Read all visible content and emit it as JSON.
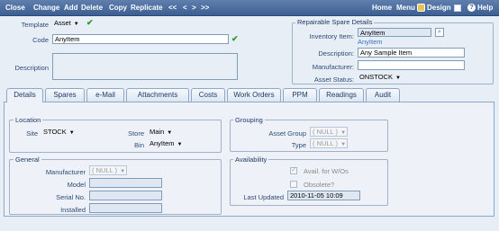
{
  "toolbar": {
    "close": "Close",
    "change": "Change",
    "add": "Add",
    "delete": "Delete",
    "copy": "Copy",
    "replicate": "Replicate",
    "first": "<<",
    "prev": "<",
    "next": ">",
    "last": ">>",
    "home": "Home",
    "menu": "Menu",
    "design": "Design",
    "help": "Help"
  },
  "header": {
    "template_label": "Template",
    "template_value": "Asset",
    "code_label": "Code",
    "code_value": "AnyItem",
    "description_label": "Description",
    "description_value": ""
  },
  "spare": {
    "title": "Repairable Spare Details",
    "inventory_label": "Inventory Item:",
    "inventory_value": "AnyItem",
    "inventory_link": "AnyItem",
    "description_label": "Description:",
    "description_value": "Any Sample Item",
    "manufacturer_label": "Manufacturer:",
    "manufacturer_value": "",
    "status_label": "Asset Status:",
    "status_value": "ONSTOCK"
  },
  "tabs": [
    "Details",
    "Spares",
    "e-Mail",
    "Attachments",
    "Costs",
    "Work Orders",
    "PPM",
    "Readings",
    "Audit"
  ],
  "location": {
    "title": "Location",
    "site_label": "Site",
    "site_value": "STOCK",
    "store_label": "Store",
    "store_value": "Main",
    "bin_label": "Bin",
    "bin_value": "AnyItem"
  },
  "grouping": {
    "title": "Grouping",
    "asset_group_label": "Asset Group",
    "asset_group_value": "( NULL )",
    "type_label": "Type",
    "type_value": "( NULL )"
  },
  "general": {
    "title": "General",
    "manufacturer_label": "Manufacturer",
    "manufacturer_value": "( NULL )",
    "model_label": "Model",
    "serial_label": "Serial No.",
    "installed_label": "Installed"
  },
  "availability": {
    "title": "Availability",
    "avail_label": "Avail. for W/Os",
    "avail_checked": true,
    "obsolete_label": "Obsolete?",
    "obsolete_checked": false,
    "last_updated_label": "Last Updated",
    "last_updated_value": "2010-11-05 10:09"
  }
}
